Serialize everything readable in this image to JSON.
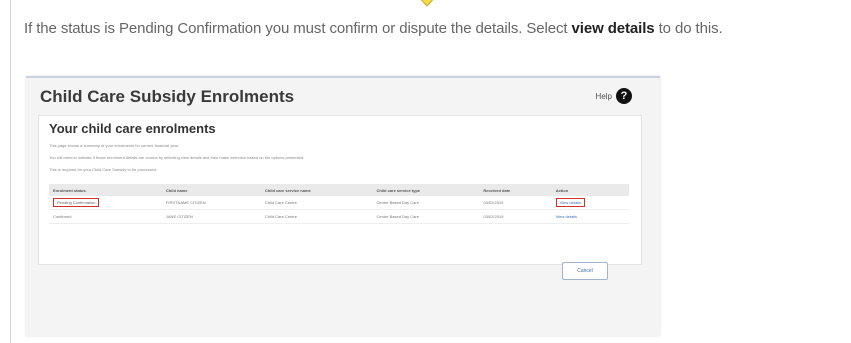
{
  "instruction": {
    "prefix": "If the status is Pending Confirmation you must confirm or dispute the details. Select ",
    "emphasis": "view details",
    "suffix": " to do this."
  },
  "panel": {
    "title": "Child Care Subsidy Enrolments",
    "help_label": "Help",
    "help_icon": "?"
  },
  "enrolments": {
    "title": "Your child care enrolments",
    "paragraphs": [
      "This page shows a summary of your enrolments for current financial year.",
      "You will need to indicate if these enrolment details are correct by selecting view details and then make selection based on the options presented.",
      "This is required for your Child Care Subsidy to be processed."
    ],
    "columns": [
      "Enrolment status",
      "Child name",
      "Child care service name",
      "Child care service type",
      "Received date",
      "Action"
    ],
    "rows": [
      [
        "Pending Confirmation",
        "FIRSTNAME CITIZEN",
        "Child Care Centre",
        "Centre Based Day Care",
        "03/02/2019",
        "View details"
      ],
      [
        "Confirmed",
        "JANE CITIZEN",
        "Child Care Centre",
        "Centre Based Day Care",
        "03/02/2019",
        "View details"
      ]
    ],
    "cancel_label": "Cancel"
  },
  "colors": {
    "highlight": "#d32f2f",
    "link": "#3b6fb6",
    "arrow": "#f5d94a"
  }
}
